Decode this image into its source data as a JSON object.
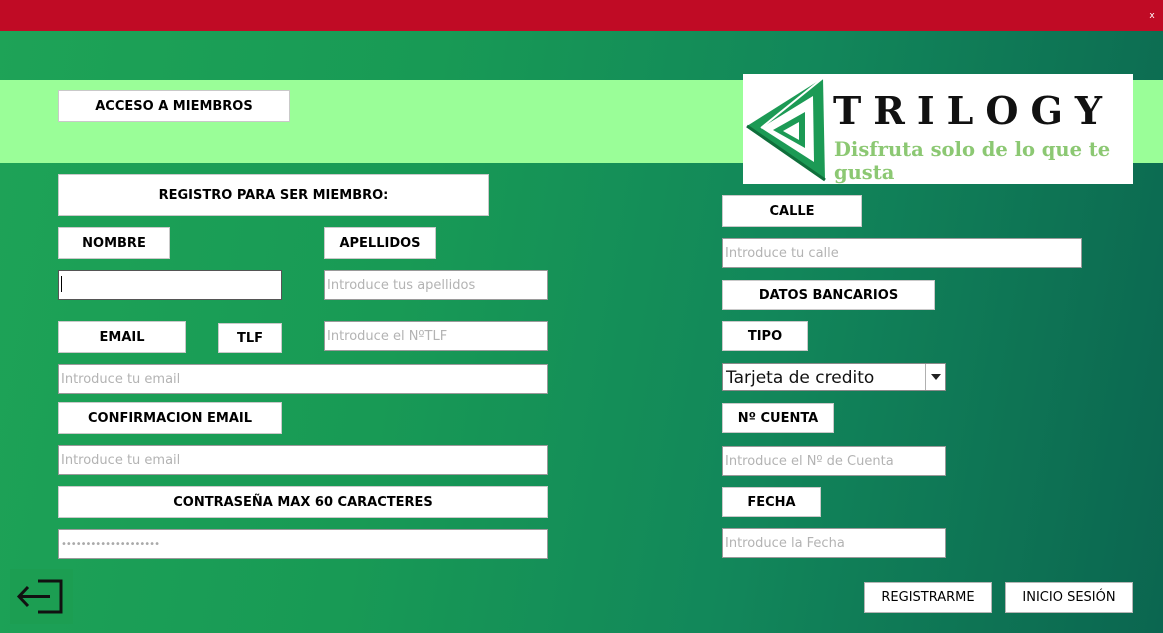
{
  "window": {
    "close_label": "x"
  },
  "colors": {
    "titlebar": "#c00b25",
    "band": "#9afe98",
    "logo_green": "#8cc873"
  },
  "header": {
    "member_access_label": "ACCESO A MIEMBROS"
  },
  "logo": {
    "title": "TRILOGY",
    "tagline": "Disfruta solo de lo que te gusta"
  },
  "form": {
    "section_title": "REGISTRO PARA SER MIEMBRO:",
    "nombre": {
      "label": "NOMBRE",
      "value": "",
      "placeholder": ""
    },
    "apellidos": {
      "label": "APELLIDOS",
      "placeholder": "Introduce tus apellidos"
    },
    "email": {
      "label": "EMAIL",
      "placeholder": "Introduce tu email"
    },
    "tlf": {
      "label": "TLF",
      "placeholder": "Introduce el NºTLF"
    },
    "email_confirm": {
      "label": "CONFIRMACION EMAIL",
      "placeholder": "Introduce tu email"
    },
    "password": {
      "label": "CONTRASEÑA MAX 60 CARACTERES",
      "masked_value": "••••••••••••••••••••"
    }
  },
  "right": {
    "calle": {
      "label": "CALLE",
      "placeholder": "Introduce tu calle"
    },
    "bank_title": "DATOS BANCARIOS",
    "tipo": {
      "label": "TIPO",
      "selected": "Tarjeta de credito"
    },
    "cuenta": {
      "label": "Nº CUENTA",
      "placeholder": "Introduce el Nº de Cuenta"
    },
    "fecha": {
      "label": "FECHA",
      "placeholder": "Introduce la Fecha"
    }
  },
  "actions": {
    "register_label": "REGISTRARME",
    "login_label": "INICIO SESIÓN"
  },
  "icons": {
    "exit": "exit-icon",
    "dropdown": "chevron-down-icon",
    "logo": "triangle-logo-icon"
  }
}
